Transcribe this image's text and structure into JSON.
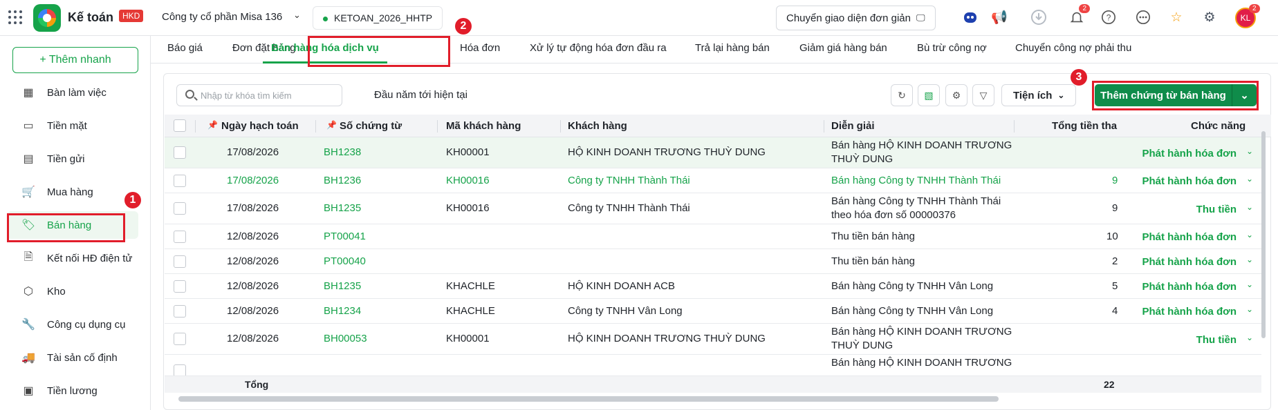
{
  "app": {
    "name": "Kế toán",
    "badge": "HKD",
    "company": "Công ty cổ phần Misa 136",
    "database": "KETOAN_2026_HHTP",
    "simple_ui_button": "Chuyển giao diện đơn giản",
    "notif_count": "2",
    "avatar_initials": "KL",
    "avatar_count": "2"
  },
  "sidebar": {
    "add_quick": "+ Thêm nhanh",
    "items": [
      {
        "label": "Bàn làm việc",
        "icon": "dashboard-icon"
      },
      {
        "label": "Tiền mặt",
        "icon": "cash-icon"
      },
      {
        "label": "Tiền gửi",
        "icon": "card-icon"
      },
      {
        "label": "Mua hàng",
        "icon": "cart-icon"
      },
      {
        "label": "Bán hàng",
        "icon": "tag-icon"
      },
      {
        "label": "Kết nối HĐ điện tử",
        "icon": "invoice-icon"
      },
      {
        "label": "Kho",
        "icon": "box-icon"
      },
      {
        "label": "Công cụ dụng cụ",
        "icon": "tool-icon"
      },
      {
        "label": "Tài sản cố định",
        "icon": "truck-icon"
      },
      {
        "label": "Tiền lương",
        "icon": "salary-icon"
      }
    ]
  },
  "tabs": [
    "Báo giá",
    "Đơn đặt hàng",
    "Bán hàng hóa dịch vụ",
    "Hóa đơn",
    "Xử lý tự động hóa đơn đầu ra",
    "Trả lại hàng bán",
    "Giảm giá hàng bán",
    "Bù trừ công nợ",
    "Chuyển công nợ phải thu"
  ],
  "toolbar": {
    "search_placeholder": "Nhập từ khóa tìm kiếm",
    "period": "Đầu năm tới hiện tại",
    "utilities": "Tiện ích",
    "add_voucher": "Thêm chứng từ bán hàng"
  },
  "markers": [
    "1",
    "2",
    "3"
  ],
  "table": {
    "headers": {
      "date": "Ngày hạch toán",
      "voucher": "Số chứng từ",
      "cust_code": "Mã khách hàng",
      "customer": "Khách hàng",
      "desc": "Diễn giải",
      "total": "Tổng tiền tha",
      "actions": "Chức năng"
    },
    "rows": [
      {
        "date": "17/08/2026",
        "voucher": "BH1238",
        "cust_code": "KH00001",
        "customer": "HỘ KINH DOANH TRƯƠNG THUỲ DUNG",
        "desc1": "Bán hàng HỘ KINH DOANH TRƯƠNG",
        "desc2": "THUỲ DUNG",
        "total": "",
        "action": "Phát hành hóa đơn"
      },
      {
        "date": "17/08/2026",
        "voucher": "BH1236",
        "cust_code": "KH00016",
        "customer": "Công ty TNHH Thành Thái",
        "desc1": "Bán hàng Công ty TNHH Thành Thái",
        "desc2": "",
        "total": "9",
        "action": "Phát hành hóa đơn"
      },
      {
        "date": "17/08/2026",
        "voucher": "BH1235",
        "cust_code": "KH00016",
        "customer": "Công ty TNHH Thành Thái",
        "desc1": "Bán hàng Công ty TNHH Thành Thái",
        "desc2": "theo hóa đơn số 00000376",
        "total": "9",
        "action": "Thu tiền"
      },
      {
        "date": "12/08/2026",
        "voucher": "PT00041",
        "cust_code": "",
        "customer": "",
        "desc1": "Thu tiền bán hàng",
        "desc2": "",
        "total": "10",
        "action": "Phát hành hóa đơn"
      },
      {
        "date": "12/08/2026",
        "voucher": "PT00040",
        "cust_code": "",
        "customer": "",
        "desc1": "Thu tiền bán hàng",
        "desc2": "",
        "total": "2",
        "action": "Phát hành hóa đơn"
      },
      {
        "date": "12/08/2026",
        "voucher": "BH1235",
        "cust_code": "KHACHLE",
        "customer": "HỘ KINH DOANH ACB",
        "desc1": "Bán hàng Công ty TNHH Vân Long",
        "desc2": "",
        "total": "5",
        "action": "Phát hành hóa đơn"
      },
      {
        "date": "12/08/2026",
        "voucher": "BH1234",
        "cust_code": "KHACHLE",
        "customer": "Công ty TNHH Vân Long",
        "desc1": "Bán hàng Công ty TNHH Vân Long",
        "desc2": "",
        "total": "4",
        "action": "Phát hành hóa đơn"
      },
      {
        "date": "12/08/2026",
        "voucher": "BH00053",
        "cust_code": "KH00001",
        "customer": "HỘ KINH DOANH TRƯƠNG THUỲ DUNG",
        "desc1": "Bán hàng HỘ KINH DOANH TRƯƠNG",
        "desc2": "THUỲ DUNG",
        "total": "",
        "action": "Thu tiền"
      },
      {
        "date": "",
        "voucher": "",
        "cust_code": "",
        "customer": "",
        "desc1": "Bán hàng HỘ KINH DOANH TRƯƠNG",
        "desc2": "",
        "total": "",
        "action": ""
      }
    ],
    "footer_label": "Tổng",
    "footer_total": "22"
  },
  "colors": {
    "accent": "#16a34a",
    "primary_button": "#0f8c4a",
    "highlight": "#e11d2a"
  }
}
